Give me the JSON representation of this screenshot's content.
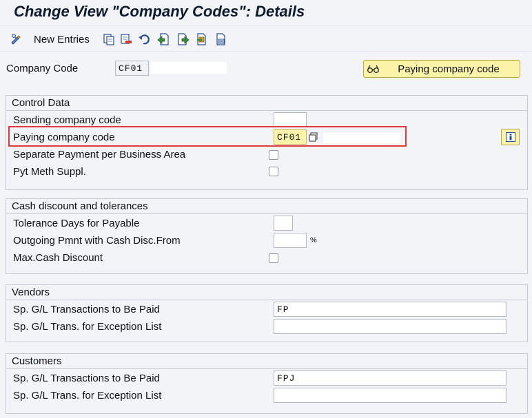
{
  "title": "Change View \"Company Codes\": Details",
  "toolbar": {
    "new_entries_label": "New Entries",
    "icons": [
      "display-change-icon",
      "copy-icon",
      "delete-icon",
      "undo-icon",
      "previous-entry-icon",
      "next-entry-icon",
      "select-all-icon",
      "print-icon"
    ]
  },
  "header": {
    "company_code_label": "Company Code",
    "company_code_value": "CF01",
    "company_name_value": "",
    "paying_company_button_label": "Paying company code"
  },
  "control_data": {
    "title": "Control Data",
    "sending_label": "Sending company code",
    "sending_value": "",
    "paying_label": "Paying company code",
    "paying_value": "CF01",
    "paying_name_value": "",
    "separate_payment_label": "Separate Payment per Business Area",
    "separate_payment_checked": false,
    "pyt_meth_label": "Pyt Meth Suppl.",
    "pyt_meth_checked": false
  },
  "cash_discount": {
    "title": "Cash discount and tolerances",
    "tolerance_days_label": "Tolerance Days for Payable",
    "tolerance_days_value": "",
    "outgoing_label": "Outgoing Pmnt with Cash Disc.From",
    "outgoing_value": "",
    "percent_sign": "%",
    "max_cash_label": "Max.Cash Discount",
    "max_cash_checked": false
  },
  "vendors": {
    "title": "Vendors",
    "sp_gl_paid_label": "Sp. G/L Transactions to Be Paid",
    "sp_gl_paid_value": "FP",
    "sp_gl_exception_label": "Sp. G/L Trans. for Exception List",
    "sp_gl_exception_value": ""
  },
  "customers": {
    "title": "Customers",
    "sp_gl_paid_label": "Sp. G/L Transactions to Be Paid",
    "sp_gl_paid_value": "FPJ",
    "sp_gl_exception_label": "Sp. G/L Trans. for Exception List",
    "sp_gl_exception_value": ""
  },
  "colors": {
    "highlight": "#e0393e",
    "button_yellow": "#fbf4a8",
    "background": "#f2f4f8"
  }
}
